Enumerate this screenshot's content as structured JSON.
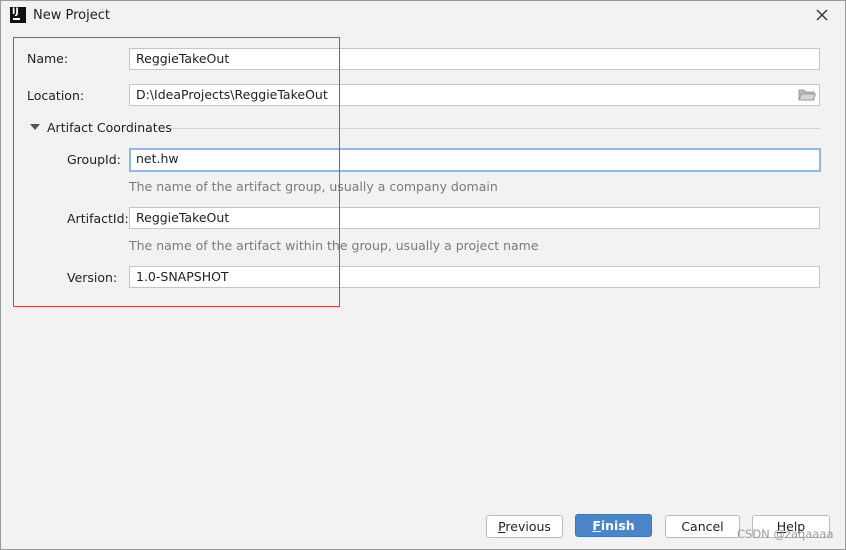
{
  "window": {
    "title": "New Project"
  },
  "form": {
    "name_label": "Name:",
    "name_value": "ReggieTakeOut",
    "location_label": "Location:",
    "location_value": "D:\\IdeaProjects\\ReggieTakeOut",
    "section_title": "Artifact Coordinates",
    "groupid_label": "GroupId:",
    "groupid_value": "net.hw",
    "groupid_hint": "The name of the artifact group, usually a company domain",
    "artifactid_label": "ArtifactId:",
    "artifactid_value": "ReggieTakeOut",
    "artifactid_hint": "The name of the artifact within the group, usually a project name",
    "version_label": "Version:",
    "version_value": "1.0-SNAPSHOT"
  },
  "buttons": {
    "previous_first": "P",
    "previous_rest": "revious",
    "finish_first": "F",
    "finish_rest": "inish",
    "cancel": "Cancel",
    "help_first": "H",
    "help_rest": "elp"
  },
  "watermark": "CSDN @zaqaaaa",
  "icons": {
    "app": "intellij-icon",
    "close": "close-icon",
    "folder": "folder-icon",
    "section_toggle": "triangle-down-icon"
  }
}
